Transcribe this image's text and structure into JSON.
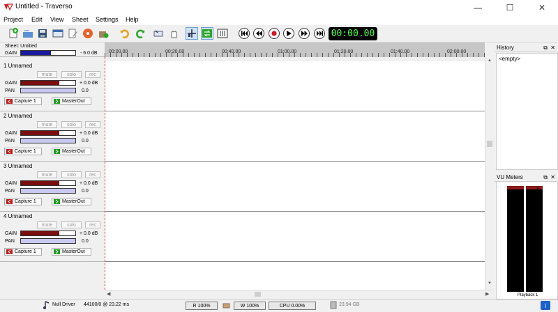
{
  "window": {
    "title": "Untitled - Traverso",
    "minimize": "—",
    "maximize": "☐",
    "close": "✕"
  },
  "menu": [
    "Project",
    "Edit",
    "View",
    "Sheet",
    "Settings",
    "Help"
  ],
  "clock": "00:00.00",
  "sheet": {
    "title": "Sheet: Untitled",
    "gain_label": "GAIN",
    "gain_value": "- 6.0 dB",
    "gain_level": 0.55
  },
  "ruler": [
    "00:00.00",
    "00:20.00",
    "00:40.00",
    "01:00.00",
    "01:20.00",
    "01:40.00",
    "02:00.00"
  ],
  "tracks": [
    {
      "name": "1  Unnamed",
      "mute": "mute",
      "solo": "solo",
      "rec": "rec",
      "gain_label": "GAIN",
      "gain_value": "+ 0.0 dB",
      "pan_label": "PAN",
      "pan_value": "0.0",
      "input": "Capture 1",
      "output": "MasterOut"
    },
    {
      "name": "2  Unnamed",
      "mute": "mute",
      "solo": "solo",
      "rec": "rec",
      "gain_label": "GAIN",
      "gain_value": "+ 0.0 dB",
      "pan_label": "PAN",
      "pan_value": "0.0",
      "input": "Capture 1",
      "output": "MasterOut"
    },
    {
      "name": "3  Unnamed",
      "mute": "mute",
      "solo": "solo",
      "rec": "rec",
      "gain_label": "GAIN",
      "gain_value": "+ 0.0 dB",
      "pan_label": "PAN",
      "pan_value": "0.0",
      "input": "Capture 1",
      "output": "MasterOut"
    },
    {
      "name": "4  Unnamed",
      "mute": "mute",
      "solo": "solo",
      "rec": "rec",
      "gain_label": "GAIN",
      "gain_value": "+ 0.0 dB",
      "pan_label": "PAN",
      "pan_value": "0.0",
      "input": "Capture 1",
      "output": "MasterOut"
    }
  ],
  "history": {
    "title": "History",
    "empty": "<empty>"
  },
  "vu": {
    "title": "VU Meters",
    "channel": "Playback 1",
    "scale": [
      "6",
      "0",
      "-5",
      "-10",
      "-15",
      "-20",
      "-25",
      "-30",
      "-35",
      "-40",
      "-45",
      "-50",
      "-60"
    ]
  },
  "status": {
    "driver": "Null Driver",
    "rate": "44100/0 @ 23.22 ms",
    "read": "R 100%",
    "write": "W 100%",
    "cpu": "CPU 0.00%",
    "disk": "23.94 GB"
  },
  "colors": {
    "gain_fill": "#7a0d0d",
    "pan_fill": "#c8c8f0",
    "sheet_gain_fill": "#1a1aa0",
    "clock_text": "#4cff4c"
  }
}
